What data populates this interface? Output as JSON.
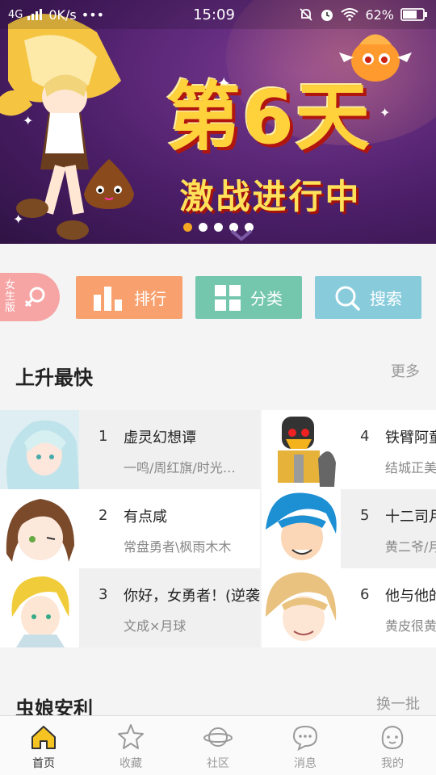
{
  "status_bar": {
    "network": "4G",
    "speed": "0K/s",
    "more": "•••",
    "time": "15:09",
    "battery": "62%"
  },
  "banner": {
    "title": "第6天",
    "subtitle": "激战进行中",
    "dot_count": 5,
    "active_dot": 0
  },
  "categories": {
    "girl_version_label": "女生版",
    "items": [
      {
        "label": "排行",
        "icon": "bar-chart-icon",
        "color": "#f8a16e"
      },
      {
        "label": "分类",
        "icon": "grid-icon",
        "color": "#74c6ad"
      },
      {
        "label": "搜索",
        "icon": "search-icon",
        "color": "#88ccdc"
      }
    ]
  },
  "rising": {
    "title": "上升最快",
    "more": "更多",
    "items": [
      {
        "rank": "1",
        "name": "虚灵幻想谭",
        "author": "一鸣/周红旗/时光…"
      },
      {
        "rank": "2",
        "name": "有点咸",
        "author": "常盘勇者\\枫雨木木"
      },
      {
        "rank": "3",
        "name": "你好，女勇者！(逆袭",
        "author": "文成×月球"
      },
      {
        "rank": "4",
        "name": "铁臂阿童",
        "author": "结城正美"
      },
      {
        "rank": "5",
        "name": "十二司月",
        "author": "黄二爷/月"
      },
      {
        "rank": "6",
        "name": "他与他的",
        "author": "黄皮很黄"
      }
    ]
  },
  "recommend": {
    "title": "虫娘安利",
    "refresh": "换一批"
  },
  "tabbar": {
    "active": 0,
    "items": [
      {
        "label": "首页",
        "icon": "home-icon"
      },
      {
        "label": "收藏",
        "icon": "star-icon"
      },
      {
        "label": "社区",
        "icon": "planet-icon"
      },
      {
        "label": "消息",
        "icon": "chat-bubble-icon"
      },
      {
        "label": "我的",
        "icon": "profile-icon"
      }
    ]
  }
}
